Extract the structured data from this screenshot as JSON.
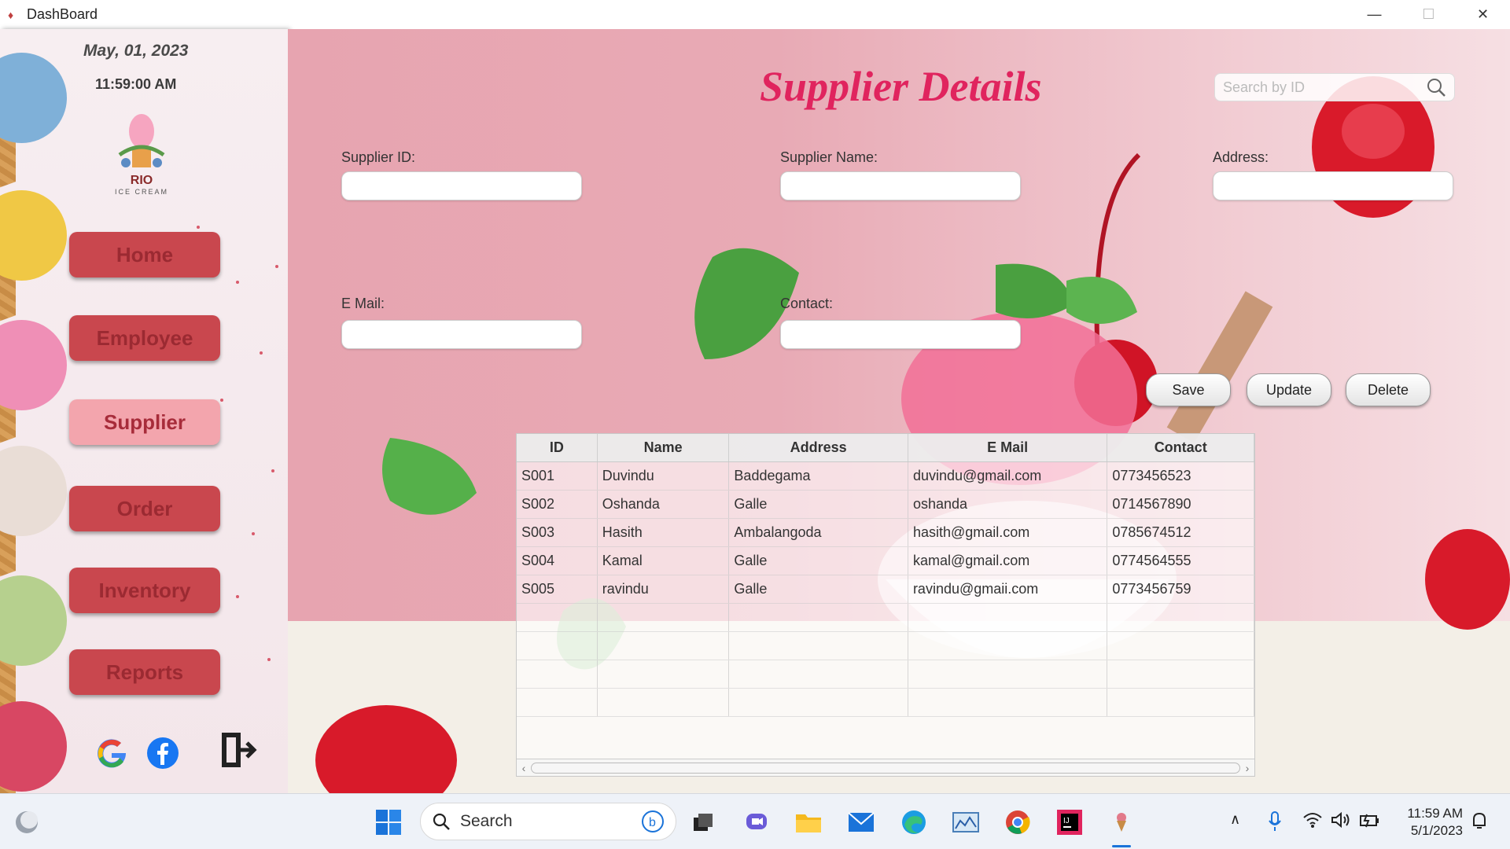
{
  "window": {
    "title": "DashBoard"
  },
  "sidebar": {
    "date": "May,  01, 2023",
    "time": "11:59:00 AM",
    "logo": {
      "name": "RIO",
      "subtitle": "ICE CREAM"
    },
    "nav": [
      {
        "label": "Home",
        "active": false
      },
      {
        "label": "Employee",
        "active": false
      },
      {
        "label": "Supplier",
        "active": true
      },
      {
        "label": "Order",
        "active": false
      },
      {
        "label": "Inventory",
        "active": false
      },
      {
        "label": "Reports",
        "active": false
      }
    ],
    "social_icons": [
      "google-icon",
      "facebook-icon",
      "logout-icon"
    ]
  },
  "main": {
    "title": "Supplier Details",
    "search": {
      "placeholder": "Search by ID"
    },
    "form": {
      "supplier_id_label": "Supplier ID:",
      "supplier_name_label": "Supplier Name:",
      "address_label": "Address:",
      "email_label": "E Mail:",
      "contact_label": "Contact:"
    },
    "buttons": {
      "save": "Save",
      "update": "Update",
      "delete": "Delete"
    },
    "table": {
      "columns": [
        "ID",
        "Name",
        "Address",
        "E Mail",
        "Contact"
      ],
      "rows": [
        [
          "S001",
          "Duvindu",
          "Baddegama",
          "duvindu@gmail.com",
          "0773456523"
        ],
        [
          "S002",
          "Oshanda",
          "Galle",
          "oshanda",
          "0714567890"
        ],
        [
          "S003",
          "Hasith",
          "Ambalangoda",
          "hasith@gmail.com",
          "0785674512"
        ],
        [
          "S004",
          "Kamal",
          "Galle",
          "kamal@gmail.com",
          "0774564555"
        ],
        [
          "S005",
          "ravindu",
          "Galle",
          "ravindu@gmaii.com",
          "0773456759"
        ]
      ]
    }
  },
  "taskbar": {
    "search_label": "Search",
    "time": "11:59 AM",
    "date": "5/1/2023"
  },
  "colors": {
    "accent": "#e0245e",
    "nav_button": "#c9474e",
    "nav_active": "#f3a5ad",
    "pink_bg": "#e7a4b0"
  }
}
